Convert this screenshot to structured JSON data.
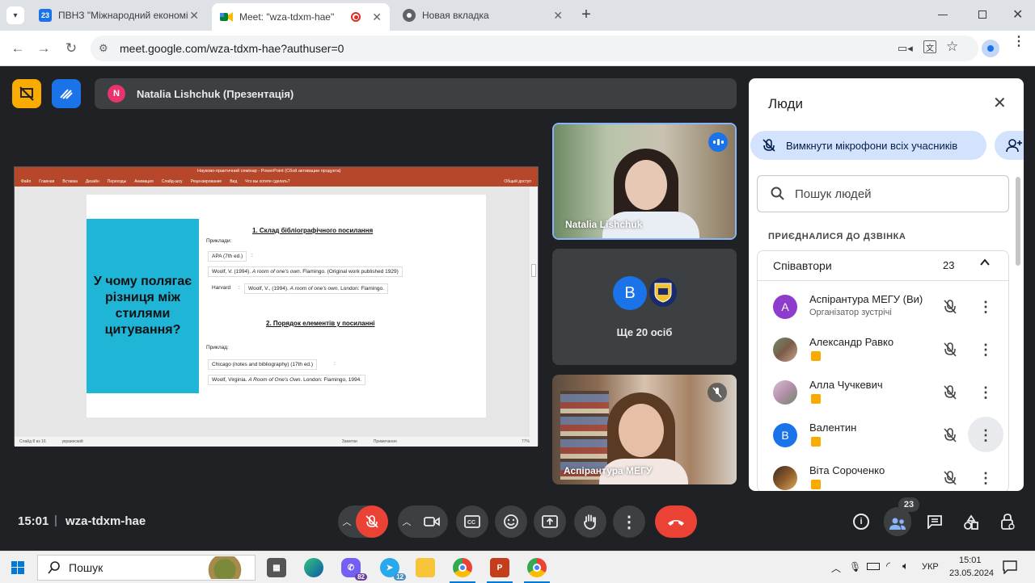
{
  "browser": {
    "tabs": [
      {
        "title": "ПВНЗ \"Міжнародний економі",
        "favicon_color": "#1a73e8",
        "favicon_text": "23"
      },
      {
        "title": "Meet: \"wza-tdxm-hae\"",
        "favicon_color": "#00832d",
        "favicon_text": ""
      },
      {
        "title": "Новая вкладка",
        "favicon_color": "#5f6368",
        "favicon_text": ""
      }
    ],
    "url": "meet.google.com/wza-tdxm-hae?authuser=0"
  },
  "meet": {
    "presenter_initial": "N",
    "presenter_label": "Natalia Lishchuk (Презентація)",
    "tiles": [
      {
        "name": "Natalia Lishchuk"
      },
      {
        "name": "Ще 20 осіб",
        "avatar": "B"
      },
      {
        "name": "Аспірантура МЕГУ"
      }
    ],
    "time": "15:01",
    "separator": "|",
    "meeting_code": "wza-tdxm-hae",
    "participants_badge": "23"
  },
  "slide": {
    "ppt_title": "Науково-практичний семінар - PowerPoint (Сбой активации продукта)",
    "ribbon_tabs": [
      "Файл",
      "Главная",
      "Вставка",
      "Дизайн",
      "Переходы",
      "Анимация",
      "Слайд-шоу",
      "Рецензирование",
      "Вид",
      "Что вы хотите сделать?",
      "Общий доступ"
    ],
    "question": "У чому полягає різниця між стилями цитування?",
    "heading1": "1. Склад бібліографічного посилання",
    "examples_label": "Приклади:",
    "apa_label": "APA (7th ed.)",
    "apa_colon": ":",
    "apa_example_pre": "Woolf, V. (1994). ",
    "apa_example_italic": "A room of one's own",
    "apa_example_post": ". Flamingo. (Original work published 1929)",
    "harvard_label": "Harvard",
    "harvard_colon": ":",
    "harvard_example_pre": "Woolf, V., (1994). ",
    "harvard_example_italic": "A room of one's own",
    "harvard_example_post": ". London: Flamingo.",
    "heading2": "2. Порядок елементів у посиланні",
    "example_label": "Приклад:",
    "chicago_label": "Chicago (notes and bibliography) (17th ed.)",
    "chicago_colon": ":",
    "chicago_example_pre": "Woolf, Virginia. ",
    "chicago_example_italic": "A Room of One's Own",
    "chicago_example_post": ". London: Flamingo, 1994.",
    "status_slide": "Слайд 8 из 16",
    "status_lang": "украинский",
    "status_notes": "Заметки",
    "status_comments": "Примечания",
    "status_zoom": "77%"
  },
  "people_panel": {
    "title": "Люди",
    "mute_all_label": "Вимкнути мікрофони всіх учасників",
    "search_placeholder": "Пошук людей",
    "section_label": "ПРИЄДНАЛИСЯ ДО ДЗВІНКА",
    "group_label": "Співавтори",
    "group_count": "23",
    "participants": [
      {
        "name": "Аспірантура МЕГУ (Ви)",
        "subtitle": "Організатор зустрічі",
        "avatar_letter": "A",
        "avatar_color": "#8e3ccb"
      },
      {
        "name": "Александр Равко",
        "subtitle": "",
        "avatar_letter": "",
        "avatar_color": "#7a5c48"
      },
      {
        "name": "Алла Чучкевич",
        "subtitle": "",
        "avatar_letter": "",
        "avatar_color": "#b38fa8"
      },
      {
        "name": "Валентин",
        "subtitle": "",
        "avatar_letter": "B",
        "avatar_color": "#1a73e8"
      },
      {
        "name": "Віта Сороченко",
        "subtitle": "",
        "avatar_letter": "",
        "avatar_color": "#8a5a2b"
      }
    ]
  },
  "taskbar": {
    "search_label": "Пошук",
    "viber_badge": "82",
    "telegram_badge": "12",
    "lang": "УКР",
    "clock_time": "15:01",
    "clock_date": "23.05.2024"
  },
  "colors": {
    "meet_bg": "#202124",
    "end_call": "#ea4335",
    "mic_off": "#ea4335",
    "accent_blue": "#1a73e8",
    "ppt_red": "#b7472a",
    "slide_cyan": "#1fb5d6"
  }
}
